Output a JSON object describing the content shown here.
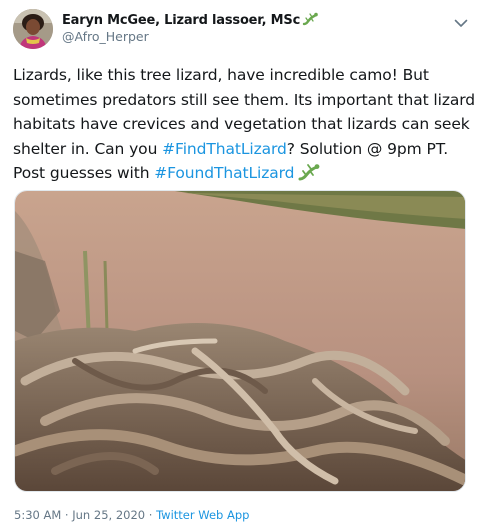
{
  "author": {
    "name": "Earyn McGee, Lizard lassoer, MSc",
    "handle": "@Afro_Herper",
    "name_emoji": "lizard-icon"
  },
  "tweet": {
    "text_part1": "Lizards, like this tree lizard, have incredible camo! But sometimes predators still see them. Its important that lizard habitats have crevices and vegetation that lizards can seek shelter in. Can you ",
    "hashtag1": "#FindThatLizard",
    "text_part2": "? Solution @ 9pm PT. Post guesses with ",
    "hashtag2": "#FoundThatLizard",
    "end_emoji": "lizard-icon"
  },
  "meta": {
    "time": "5:30 AM",
    "separator": " · ",
    "date": "Jun 25, 2020",
    "source": "Twitter Web App"
  },
  "colors": {
    "link": "#1b95e0",
    "muted": "#657786",
    "lizard_emoji": "#6aa84f"
  },
  "icons": [
    "chevron-down-icon",
    "lizard-icon"
  ]
}
